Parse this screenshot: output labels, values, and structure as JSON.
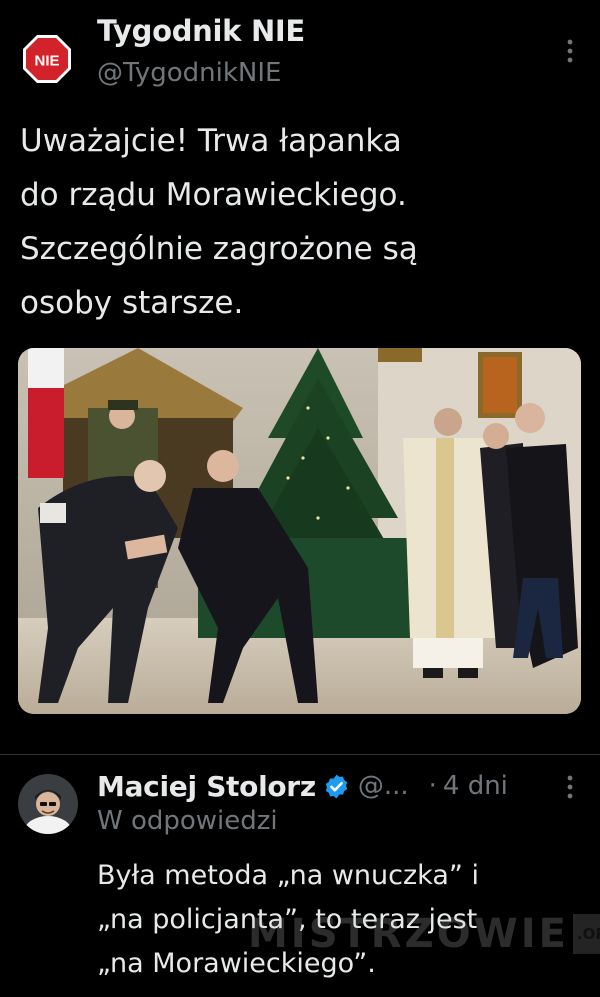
{
  "tweet": {
    "author": {
      "display_name": "Tygodnik NIE",
      "handle": "@TygodnikNIE",
      "avatar_text": "NIE"
    },
    "text": "Uważajcie! Trwa łapanka\ndo rządu Morawieckiego.\nSzczególnie zagrożone są\nosoby starsze.",
    "media": {
      "kind": "photo"
    }
  },
  "reply": {
    "author": {
      "display_name": "Maciej Stolorz",
      "handle": "@...",
      "verified": true
    },
    "separator": "·",
    "time": "4 dni",
    "context": "W odpowiedzi",
    "text": "Była metoda „na wnuczka” i\n„na policjanta”, to teraz jest\n„na Morawieckiego”."
  },
  "watermark": {
    "main": "MISTRZOWIE",
    "suffix": ".ORG"
  },
  "icons": [
    "more-vertical-icon",
    "verified-badge-icon",
    "nie-logo-icon"
  ],
  "colors": {
    "background": "#000000",
    "text_primary": "#e7e9ea",
    "text_secondary": "#71767b",
    "verified_blue": "#1d9bf0",
    "divider": "#2f3336",
    "nie_red": "#d2232a"
  }
}
